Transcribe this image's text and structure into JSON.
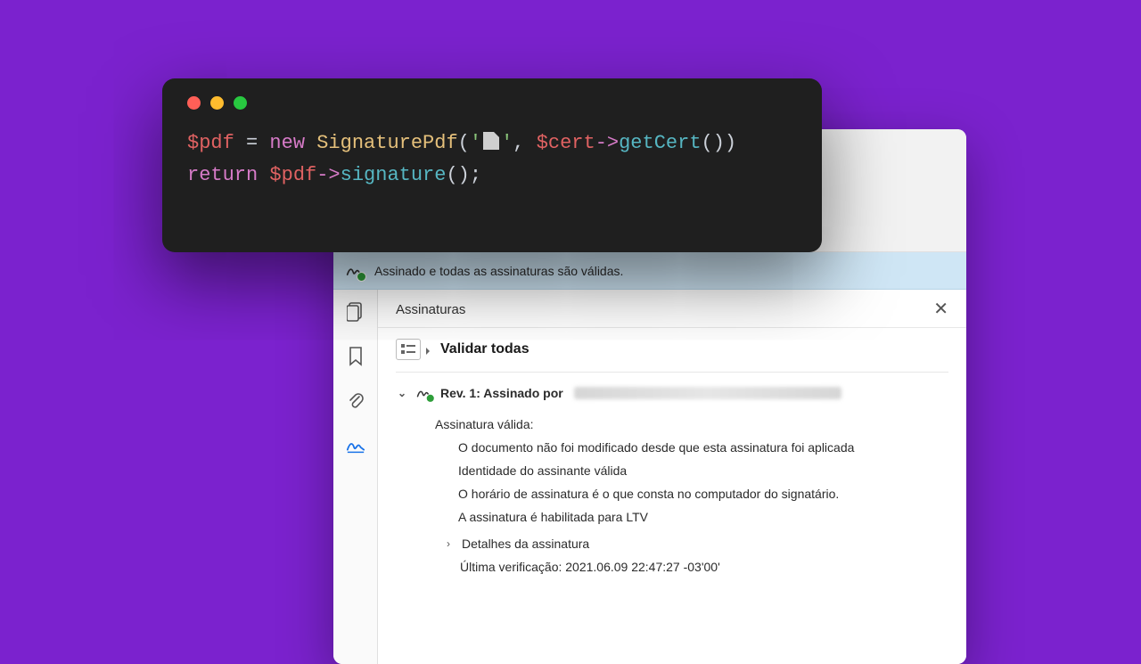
{
  "code": {
    "line1": {
      "var": "$pdf",
      "eq": " = ",
      "kw": "new",
      "sp": " ",
      "cls": "SignaturePdf",
      "lp": "(",
      "q1": "'",
      "q2": "'",
      "comma": ", ",
      "var2": "$cert",
      "arrow": "->",
      "fn": "getCert",
      "rp": "())"
    },
    "line2": {
      "kw": "return",
      "sp": " ",
      "var": "$pdf",
      "arrow": "->",
      "fn": "signature",
      "rp": "();"
    }
  },
  "pdf": {
    "status_text": "Assinado e todas as assinaturas são válidas.",
    "panel_title": "Assinaturas",
    "validate_all": "Validar todas",
    "rev_label": "Rev. 1: Assinado por",
    "valid_label": "Assinatura válida:",
    "d1": "O documento não foi modificado desde que esta assinatura foi aplicada",
    "d2": "Identidade do assinante válida",
    "d3": "O horário de assinatura é o que consta no computador do signatário.",
    "d4": "A assinatura é habilitada para LTV",
    "details_label": "Detalhes da assinatura",
    "last_check": "Última verificação: 2021.06.09 22:47:27 -03'00'"
  }
}
